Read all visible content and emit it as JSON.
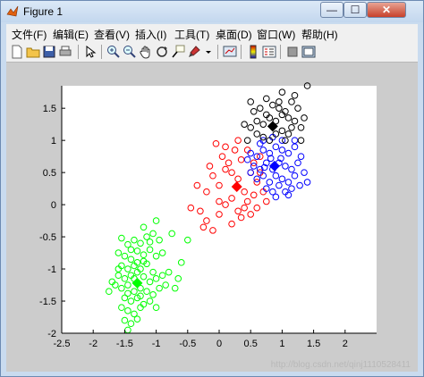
{
  "window": {
    "title": "Figure 1",
    "minimize_glyph": "—",
    "maximize_glyph": "☐",
    "close_glyph": "✕"
  },
  "menu": [
    "文件(F)",
    "编辑(E)",
    "查看(V)",
    "插入(I)",
    "工具(T)",
    "桌面(D)",
    "窗口(W)",
    "帮助(H)"
  ],
  "toolbar_icons": [
    "new-figure-icon",
    "open-file-icon",
    "save-icon",
    "print-icon",
    "pointer-icon",
    "zoom-in-icon",
    "zoom-out-icon",
    "pan-icon",
    "rotate-icon",
    "data-cursor-icon",
    "brush-icon",
    "link-plot-icon",
    "colorbar-icon",
    "legend-icon",
    "hide-plot-tools-icon",
    "show-plot-tools-icon"
  ],
  "watermark": "http://blog.csdn.net/qinj1110528411",
  "chart_data": {
    "type": "scatter",
    "xlim": [
      -2.5,
      2.5
    ],
    "ylim": [
      -2,
      1.85
    ],
    "xticks": [
      "-2.5",
      "-2",
      "-1.5",
      "-1",
      "-0.5",
      "0",
      "0.5",
      "1",
      "1.5",
      "2"
    ],
    "yticks": [
      "1.5",
      "1",
      "0.5",
      "0",
      "-0.5",
      "-1",
      "-1.5",
      "-2"
    ],
    "grid": false,
    "series": [
      {
        "color": "#00ff00",
        "marker": "circle-open",
        "centroid": [
          -1.3,
          -1.22
        ],
        "points": [
          [
            -1.55,
            -0.52
          ],
          [
            -1.45,
            -0.62
          ],
          [
            -1.35,
            -0.55
          ],
          [
            -1.25,
            -0.6
          ],
          [
            -1.15,
            -0.5
          ],
          [
            -1.05,
            -0.45
          ],
          [
            -0.95,
            -0.55
          ],
          [
            -1.2,
            -0.35
          ],
          [
            -1.0,
            -0.25
          ],
          [
            -1.6,
            -0.75
          ],
          [
            -1.5,
            -0.8
          ],
          [
            -1.4,
            -0.85
          ],
          [
            -1.3,
            -0.72
          ],
          [
            -1.2,
            -0.78
          ],
          [
            -1.1,
            -0.7
          ],
          [
            -1.0,
            -0.8
          ],
          [
            -0.9,
            -0.75
          ],
          [
            -1.55,
            -0.95
          ],
          [
            -1.45,
            -1.0
          ],
          [
            -1.35,
            -0.95
          ],
          [
            -1.25,
            -1.0
          ],
          [
            -1.15,
            -0.92
          ],
          [
            -1.05,
            -1.05
          ],
          [
            -1.6,
            -1.1
          ],
          [
            -1.5,
            -1.15
          ],
          [
            -1.4,
            -1.1
          ],
          [
            -1.3,
            -1.05
          ],
          [
            -1.2,
            -1.12
          ],
          [
            -1.1,
            -1.2
          ],
          [
            -1.0,
            -1.15
          ],
          [
            -0.9,
            -1.1
          ],
          [
            -1.65,
            -1.25
          ],
          [
            -1.55,
            -1.3
          ],
          [
            -1.45,
            -1.25
          ],
          [
            -1.35,
            -1.35
          ],
          [
            -1.25,
            -1.3
          ],
          [
            -1.15,
            -1.35
          ],
          [
            -1.05,
            -1.4
          ],
          [
            -0.95,
            -1.3
          ],
          [
            -1.5,
            -1.45
          ],
          [
            -1.4,
            -1.5
          ],
          [
            -1.3,
            -1.45
          ],
          [
            -1.2,
            -1.55
          ],
          [
            -1.1,
            -1.5
          ],
          [
            -1.55,
            -1.6
          ],
          [
            -1.45,
            -1.65
          ],
          [
            -1.35,
            -1.7
          ],
          [
            -1.25,
            -1.6
          ],
          [
            -1.5,
            -1.8
          ],
          [
            -1.4,
            -1.85
          ],
          [
            -1.3,
            -1.78
          ],
          [
            -1.45,
            -1.95
          ],
          [
            -1.75,
            -1.35
          ],
          [
            -0.8,
            -1.05
          ],
          [
            -0.7,
            -1.3
          ],
          [
            -0.65,
            -1.15
          ],
          [
            -0.85,
            -1.25
          ],
          [
            -1.0,
            -1.6
          ],
          [
            -0.6,
            -0.9
          ],
          [
            -0.5,
            -0.55
          ],
          [
            -0.75,
            -0.45
          ],
          [
            -1.4,
            -0.7
          ],
          [
            -1.3,
            -0.9
          ],
          [
            -1.6,
            -1.0
          ],
          [
            -1.7,
            -1.2
          ],
          [
            -1.2,
            -0.88
          ],
          [
            -1.1,
            -0.58
          ],
          [
            -1.45,
            -1.38
          ],
          [
            -1.35,
            -1.15
          ],
          [
            -1.25,
            -1.42
          ]
        ]
      },
      {
        "color": "#ff0000",
        "marker": "circle-open",
        "centroid": [
          0.28,
          0.28
        ],
        "points": [
          [
            -0.1,
            0.45
          ],
          [
            0.0,
            0.3
          ],
          [
            0.1,
            0.55
          ],
          [
            0.2,
            0.1
          ],
          [
            0.3,
            0.4
          ],
          [
            0.4,
            0.2
          ],
          [
            0.5,
            0.5
          ],
          [
            0.6,
            0.35
          ],
          [
            0.05,
            0.75
          ],
          [
            0.15,
            0.65
          ],
          [
            0.25,
            0.85
          ],
          [
            0.35,
            0.7
          ],
          [
            0.45,
            0.85
          ],
          [
            0.55,
            0.65
          ],
          [
            0.65,
            0.5
          ],
          [
            0.7,
            0.2
          ],
          [
            0.0,
            0.05
          ],
          [
            0.1,
            0.0
          ],
          [
            0.3,
            -0.1
          ],
          [
            0.4,
            -0.05
          ],
          [
            0.5,
            -0.15
          ],
          [
            0.6,
            -0.05
          ],
          [
            -0.2,
            0.2
          ],
          [
            -0.3,
            -0.1
          ],
          [
            -0.2,
            -0.25
          ],
          [
            -0.1,
            -0.4
          ],
          [
            0.0,
            -0.15
          ],
          [
            0.2,
            -0.3
          ],
          [
            0.45,
            0.05
          ],
          [
            0.55,
            0.15
          ],
          [
            0.1,
            0.9
          ],
          [
            0.3,
            1.0
          ],
          [
            -0.05,
            0.95
          ],
          [
            0.2,
            0.5
          ],
          [
            -0.15,
            0.6
          ],
          [
            0.75,
            0.05
          ],
          [
            0.35,
            -0.2
          ],
          [
            -0.35,
            0.3
          ],
          [
            -0.45,
            -0.05
          ],
          [
            -0.25,
            -0.35
          ],
          [
            0.65,
            0.75
          ]
        ]
      },
      {
        "color": "#0000ff",
        "marker": "circle-open",
        "centroid": [
          0.88,
          0.6
        ],
        "points": [
          [
            0.5,
            0.8
          ],
          [
            0.6,
            0.75
          ],
          [
            0.7,
            0.85
          ],
          [
            0.8,
            0.8
          ],
          [
            0.9,
            0.9
          ],
          [
            1.0,
            0.85
          ],
          [
            1.1,
            0.8
          ],
          [
            1.2,
            0.9
          ],
          [
            0.55,
            0.6
          ],
          [
            0.65,
            0.55
          ],
          [
            0.75,
            0.65
          ],
          [
            0.85,
            0.55
          ],
          [
            0.95,
            0.65
          ],
          [
            1.05,
            0.6
          ],
          [
            1.15,
            0.55
          ],
          [
            1.25,
            0.65
          ],
          [
            0.6,
            0.4
          ],
          [
            0.7,
            0.45
          ],
          [
            0.8,
            0.35
          ],
          [
            0.9,
            0.45
          ],
          [
            1.0,
            0.4
          ],
          [
            1.1,
            0.35
          ],
          [
            1.2,
            0.45
          ],
          [
            0.75,
            0.25
          ],
          [
            0.85,
            0.2
          ],
          [
            0.95,
            0.3
          ],
          [
            1.05,
            0.2
          ],
          [
            1.15,
            0.25
          ],
          [
            0.7,
            1.0
          ],
          [
            0.85,
            1.05
          ],
          [
            1.0,
            1.0
          ],
          [
            1.3,
            0.75
          ],
          [
            1.35,
            0.5
          ],
          [
            1.4,
            0.35
          ],
          [
            0.5,
            0.5
          ],
          [
            0.65,
            0.95
          ],
          [
            1.2,
            1.0
          ],
          [
            0.9,
            0.12
          ],
          [
            1.1,
            0.15
          ],
          [
            0.45,
            0.7
          ],
          [
            0.82,
            0.72
          ],
          [
            0.98,
            0.72
          ],
          [
            0.72,
            0.58
          ],
          [
            1.28,
            0.3
          ]
        ]
      },
      {
        "color": "#000000",
        "marker": "circle-open",
        "centroid": [
          0.85,
          1.22
        ],
        "points": [
          [
            0.5,
            1.2
          ],
          [
            0.6,
            1.3
          ],
          [
            0.7,
            1.25
          ],
          [
            0.8,
            1.35
          ],
          [
            0.9,
            1.3
          ],
          [
            1.0,
            1.4
          ],
          [
            1.1,
            1.35
          ],
          [
            1.2,
            1.3
          ],
          [
            0.55,
            1.45
          ],
          [
            0.65,
            1.5
          ],
          [
            0.75,
            1.4
          ],
          [
            0.85,
            1.55
          ],
          [
            0.95,
            1.5
          ],
          [
            1.05,
            1.45
          ],
          [
            1.15,
            1.6
          ],
          [
            1.25,
            1.5
          ],
          [
            0.6,
            1.1
          ],
          [
            0.7,
            1.05
          ],
          [
            0.9,
            1.1
          ],
          [
            1.0,
            1.15
          ],
          [
            1.1,
            1.1
          ],
          [
            1.3,
            1.2
          ],
          [
            1.4,
            1.85
          ],
          [
            1.2,
            1.7
          ],
          [
            1.0,
            1.75
          ],
          [
            0.75,
            1.65
          ],
          [
            1.35,
            1.35
          ],
          [
            0.45,
            1.0
          ],
          [
            0.4,
            1.25
          ],
          [
            0.95,
            1.6
          ],
          [
            1.15,
            1.2
          ],
          [
            0.8,
            1.0
          ],
          [
            1.05,
            1.0
          ],
          [
            0.5,
            1.6
          ],
          [
            1.3,
            1.0
          ]
        ]
      }
    ]
  }
}
